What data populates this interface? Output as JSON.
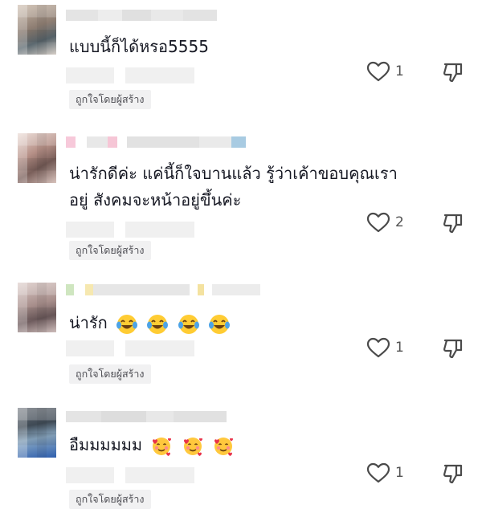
{
  "comments": [
    {
      "text": "แบบนี้ก็ได้หรอ5555",
      "like_count": "1",
      "liked_by_creator": "ถูกใจโดยผู้สร้าง",
      "emojis": []
    },
    {
      "text_line1": "น่ารักดีค่ะ แค่นี้ก็ใจบานแล้ว รู้ว่าเค้าขอบคุณเรา",
      "text_line2": "อยู่ สังคมจะหน้าอยู่ขึ้นค่ะ",
      "like_count": "2",
      "liked_by_creator": "ถูกใจโดยผู้สร้าง",
      "emojis": []
    },
    {
      "text": "น่ารัก",
      "like_count": "1",
      "liked_by_creator": "ถูกใจโดยผู้สร้าง",
      "emojis": [
        "joy-tears-emoji",
        "joy-tears-emoji",
        "joy-tears-emoji",
        "joy-tears-emoji"
      ]
    },
    {
      "text": "อืมมมมมม",
      "like_count": "1",
      "liked_by_creator": "ถูกใจโดยผู้สร้าง",
      "emojis": [
        "smiling-hearts-emoji",
        "smiling-hearts-emoji",
        "smiling-hearts-emoji"
      ]
    }
  ],
  "icons": {
    "like": "heart-outline-icon",
    "dislike": "thumbs-down-outline-icon"
  },
  "colors": {
    "text": "#161823",
    "meta": "#4c4c52",
    "badge_bg": "#f1f1f2"
  }
}
